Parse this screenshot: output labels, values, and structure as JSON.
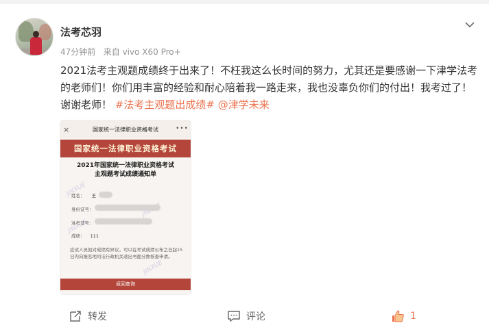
{
  "post": {
    "username": "法考芯羽",
    "time": "47分钟前",
    "source": "来自 vivo X60 Pro+",
    "text_main": "2021法考主观题成绩终于出来了！不枉我这么长时间的努力，尤其还是要感谢一下津学法考的老师们！你们用丰富的经验和耐心陪着我一路走来，我也没辜负你们的付出！我考过了！谢谢老师！",
    "hashtag": "#法考主观题出成绩#",
    "mention": "@津学未来"
  },
  "image": {
    "topbar_title": "国家统一法律职业资格考试",
    "close_glyph": "×",
    "more_glyph": "•••",
    "banner": "国家统一法律职业资格考试",
    "heading_line1": "2021年国家统一法律职业资格考试",
    "heading_line2": "主观题考试成绩通知单",
    "label_name": "姓名：",
    "name_char": "王",
    "label_id": "身份证号：",
    "label_exam": "准考证号：",
    "label_score": "成绩：",
    "score": "111",
    "note": "应试人员如对成绩有异议，可以在考试成绩公布之日起15日内向报名地司法行政机关递出书面分数核查申请。",
    "button": "返回查询",
    "watermark": "JINXUE"
  },
  "actions": {
    "repost_label": "转发",
    "comment_label": "评论",
    "like_count": "1"
  },
  "colors": {
    "accent": "#eb7350",
    "image_red": "#b3453a"
  }
}
